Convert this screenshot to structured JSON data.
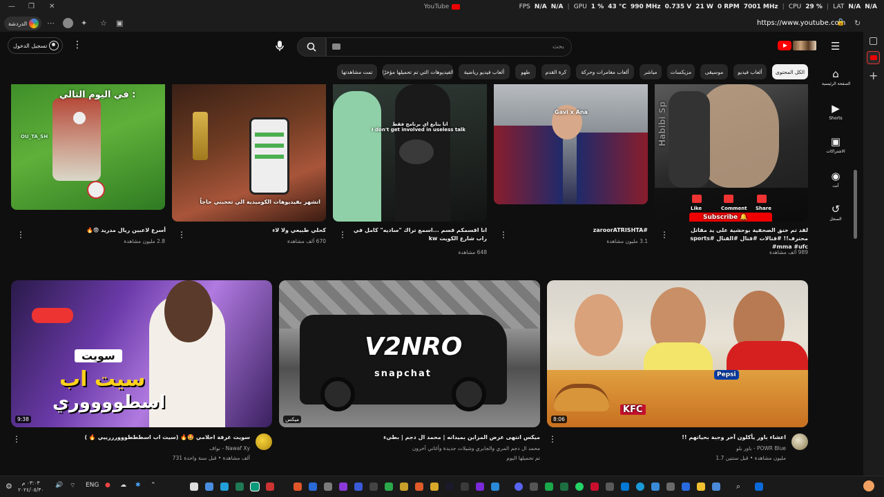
{
  "titlebar": {
    "title": "YouTube"
  },
  "osd": {
    "fps_label": "FPS",
    "fps_1": "N/A",
    "fps_2": "N/A",
    "gpu_label": "GPU",
    "gpu_load": "1 %",
    "gpu_temp": "43 °C",
    "gpu_clock": "990 MHz",
    "gpu_volt": "0.735 V",
    "gpu_power": "21 W",
    "gpu_fan": "0 RPM",
    "gpu_mem": "7001 MHz",
    "cpu_label": "CPU",
    "cpu_load": "29 %",
    "lat_label": "LAT",
    "lat_1": "N/A",
    "lat_2": "N/A"
  },
  "browser": {
    "chat_label": "الدردشة",
    "url": "https://www.youtube.com"
  },
  "header": {
    "signin_label": "تسجيل الدخول",
    "search_placeholder": "بحث"
  },
  "chips": [
    "الكل المحتوى",
    "ألعاب فيديو",
    "موسيقى",
    "مزيكسات",
    "مباشر",
    "ألعاب مغامرات وحركة",
    "كرة القدم",
    "طهو",
    "ألعاب فيديو رياضية",
    "الفيديوهات التي تم تحميلها مؤخرًا",
    "تمت مشاهدتها"
  ],
  "sidebar": {
    "home": "الصفحة الرئيسية",
    "shorts": "Shorts",
    "subs": "الاشتراكات",
    "you": "أنت",
    "history": "السجل"
  },
  "shorts": [
    {
      "title": "أسرع لاعبين ريال مدريد 😨🔥",
      "views": "2.8 مليون مشاهدة",
      "overlay": "في اليوم التالي :",
      "tag": "OU_TA_SH"
    },
    {
      "title": "كحلي طبيعي ولا لاء",
      "views": "670 ألف مشاهدة",
      "overlay": "اتشهر بفيديوهات الكوميدية الي تعجبني حاجاً"
    },
    {
      "title": "انا اقسمكم قسم ...اسمع تراك \"ساديه\" كامل في راب شارع الكويت kw",
      "views": "648 مشاهدة",
      "sub_ar": "انا بتابع اي برنامج فقط",
      "sub_en": "I don't get involved in useless talk"
    },
    {
      "title": "#zaroorATRISHTA",
      "views": "3.1 مليون مشاهدة",
      "overlay": "Gavi x Ana"
    },
    {
      "title": "لقد تم خنق الصحفية بوحشية على يد مقاتل محترف!! #قتالات #قتال #القتال #sports #mma #ufc",
      "views": "989 ألف مشاهدة",
      "like": "Like",
      "comment": "Comment",
      "share": "Share",
      "subscribe": "Subscribe 🔔",
      "brand": "Habibi Sp"
    }
  ],
  "videos": [
    {
      "title": "سويت غرفة احلامي 🤩🔥 (سيت اب اسطططووورررييي 🔥 )",
      "channel": "Nawaf Xy - نواف",
      "views": "731 ألف مشاهدة",
      "age": "قبل سنة واحدة",
      "duration": "9:38",
      "overlay_1": "سويت",
      "overlay_2": "سيت اب",
      "overlay_3": "اسطووووري"
    },
    {
      "title": "ميكس انتهى عرض المزاين بميدانه | محمد ال دجم | بطيء",
      "channel": "محمد ال دجم المري والجابري وشيلات جديدة وأغاني آخرون",
      "views": "تم تحميلها اليوم",
      "age": "",
      "duration": "ميكس",
      "overlay_1": "V2NRO",
      "overlay_2": "snapchat"
    },
    {
      "title": "اعشاء باور يأكلون آخر وجبة بحياتهم !!",
      "channel": "POWR Blue - باور بلو",
      "views": "1.7 مليون مشاهدة",
      "age": "قبل سنتين",
      "duration": "8:06",
      "overlay_1": "KFC",
      "overlay_2": "Pepsi"
    }
  ],
  "taskbar": {
    "time": "٠٣:٠٣ م",
    "date": "٢٠٢٤/٠٥/٣٠",
    "lang": "ENG"
  }
}
